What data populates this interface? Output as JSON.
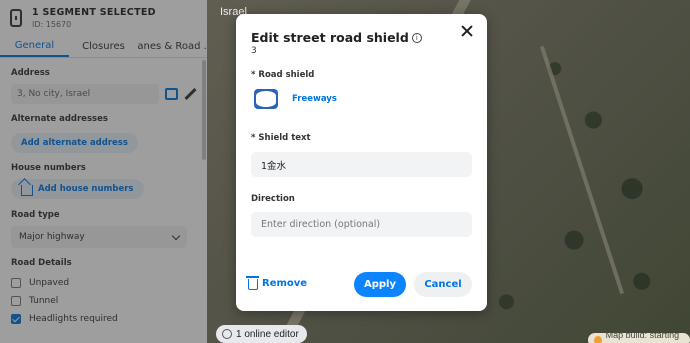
{
  "sidebar": {
    "title": "1 SEGMENT SELECTED",
    "id_text": "ID: 15670",
    "tabs": [
      "General",
      "Closures",
      "Lanes & Road ..."
    ],
    "address_label": "Address",
    "address_value": "3, No city, Israel",
    "alternate_label": "Alternate addresses",
    "alternate_button": "Add alternate address",
    "house_label": "House numbers",
    "house_button": "Add house numbers",
    "road_type_label": "Road type",
    "road_type_value": "Major highway",
    "road_details_label": "Road Details",
    "details": [
      {
        "label": "Unpaved",
        "checked": false
      },
      {
        "label": "Tunnel",
        "checked": false
      },
      {
        "label": "Headlights required",
        "checked": true
      }
    ]
  },
  "map": {
    "region_label": "Israel",
    "online_editors": "1 online editor",
    "status": "Map build: starting now"
  },
  "modal": {
    "title": "Edit street road shield",
    "subtitle": "3",
    "shield_label": "* Road shield",
    "shield_name": "Freeways",
    "shield_text_label": "* Shield text",
    "shield_text_value": "1金水",
    "direction_label": "Direction",
    "direction_placeholder": "Enter direction (optional)",
    "remove_label": "Remove",
    "apply_label": "Apply",
    "cancel_label": "Cancel"
  },
  "colors": {
    "accent": "#0075e3",
    "apply_bg": "#0a84ff",
    "shield": "#2a63b8"
  }
}
